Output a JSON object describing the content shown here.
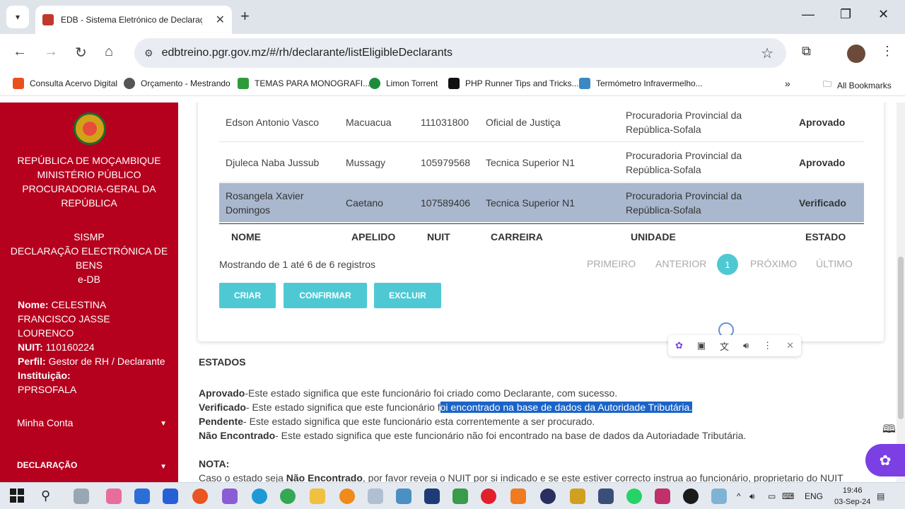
{
  "browser": {
    "tab_title": "EDB - Sistema Eletrónico de Declaração de",
    "url": "edbtreino.pgr.gov.mz/#/rh/declarante/listEligibleDeclarants",
    "bookmarks": [
      {
        "label": "Consulta Acervo Digital",
        "color": "#e8501f"
      },
      {
        "label": "Orçamento - Mestrando",
        "color": "#555555"
      },
      {
        "label": "TEMAS PARA MONOGRAFI...",
        "color": "#2e9b3a"
      },
      {
        "label": "Limon Torrent",
        "color": "#1c8c3c"
      },
      {
        "label": "PHP Runner Tips and Tricks...",
        "color": "#111111"
      },
      {
        "label": "Termómetro Infravermelho...",
        "color": "#3b88c3"
      }
    ],
    "all_bookmarks": "All Bookmarks"
  },
  "sidebar": {
    "org_lines": [
      "REPÚBLICA DE MOÇAMBIQUE",
      "MINISTÉRIO PÚBLICO",
      "PROCURADORIA-GERAL DA",
      "REPÚBLICA"
    ],
    "sys_lines": [
      "SISMP",
      "DECLARAÇÃO ELECTRÓNICA DE",
      "BENS",
      "e-DB"
    ],
    "user": {
      "name_label": "Nome:",
      "name": "CELESTINA FRANCISCO JASSE LOURENCO",
      "nuit_label": "NUIT:",
      "nuit": "110160224",
      "perfil_label": "Perfil:",
      "perfil": "Gestor de RH / Declarante",
      "inst_label": "Instituição:",
      "inst": "PPRSOFALA"
    },
    "account": "Minha Conta",
    "declaracao": "DECLARAÇÃO"
  },
  "table": {
    "rows": [
      {
        "nome": "Edson Antonio Vasco",
        "apelido": "Macuacua",
        "nuit": "111031800",
        "carreira": "Oficial de Justiça",
        "unidade": "Procuradoria Provincial da República-Sofala",
        "estado": "Aprovado"
      },
      {
        "nome": "Djuleca Naba Jussub",
        "apelido": "Mussagy",
        "nuit": "105979568",
        "carreira": "Tecnica Superior N1",
        "unidade": "Procuradoria Provincial da República-Sofala",
        "estado": "Aprovado"
      },
      {
        "nome": "Rosangela Xavier Domingos",
        "apelido": "Caetano",
        "nuit": "107589406",
        "carreira": "Tecnica Superior N1",
        "unidade": "Procuradoria Provincial da República-Sofala",
        "estado": "Verificado"
      }
    ],
    "headers": {
      "nome": "NOME",
      "apelido": "APELIDO",
      "nuit": "NUIT",
      "carreira": "CARREIRA",
      "unidade": "UNIDADE",
      "estado": "ESTADO"
    },
    "info": "Mostrando de 1 até 6 de 6 registros",
    "pager": {
      "first": "PRIMEIRO",
      "prev": "ANTERIOR",
      "current": "1",
      "next": "PRÓXIMO",
      "last": "ÚLTIMO"
    },
    "buttons": {
      "criar": "CRIAR",
      "confirmar": "CONFIRMAR",
      "excluir": "EXCLUIR"
    }
  },
  "legend": {
    "title": "ESTADOS",
    "items": [
      {
        "term": "Aprovado",
        "desc": "-Este estado significa que este funcionário foi criado como Declarante, com sucesso."
      },
      {
        "term": "Verificado",
        "desc_pre": "- Este estado significa que este funcionário f",
        "desc_hl": "oi encontrado na base de dados da Autoridade Tributária."
      },
      {
        "term": "Pendente",
        "desc": "- Este estado significa que este funcionário esta correntemente a ser procurado."
      },
      {
        "term": "Não Encontrado",
        "desc": "- Este estado significa que este funcionário não foi encontrado na base de dados da Autoriadade Tributária."
      }
    ],
    "nota_title": "NOTA:",
    "nota_pre": "Caso o estado seja ",
    "nota_term": "Não Encontrado",
    "nota_post": ", por favor reveja o NUIT por si indicado e se este estiver correcto instrua ao funcionário, proprietario do NUIT"
  },
  "taskbar": {
    "lang": "ENG",
    "time": "19:46",
    "date": "03-Sep-24"
  }
}
